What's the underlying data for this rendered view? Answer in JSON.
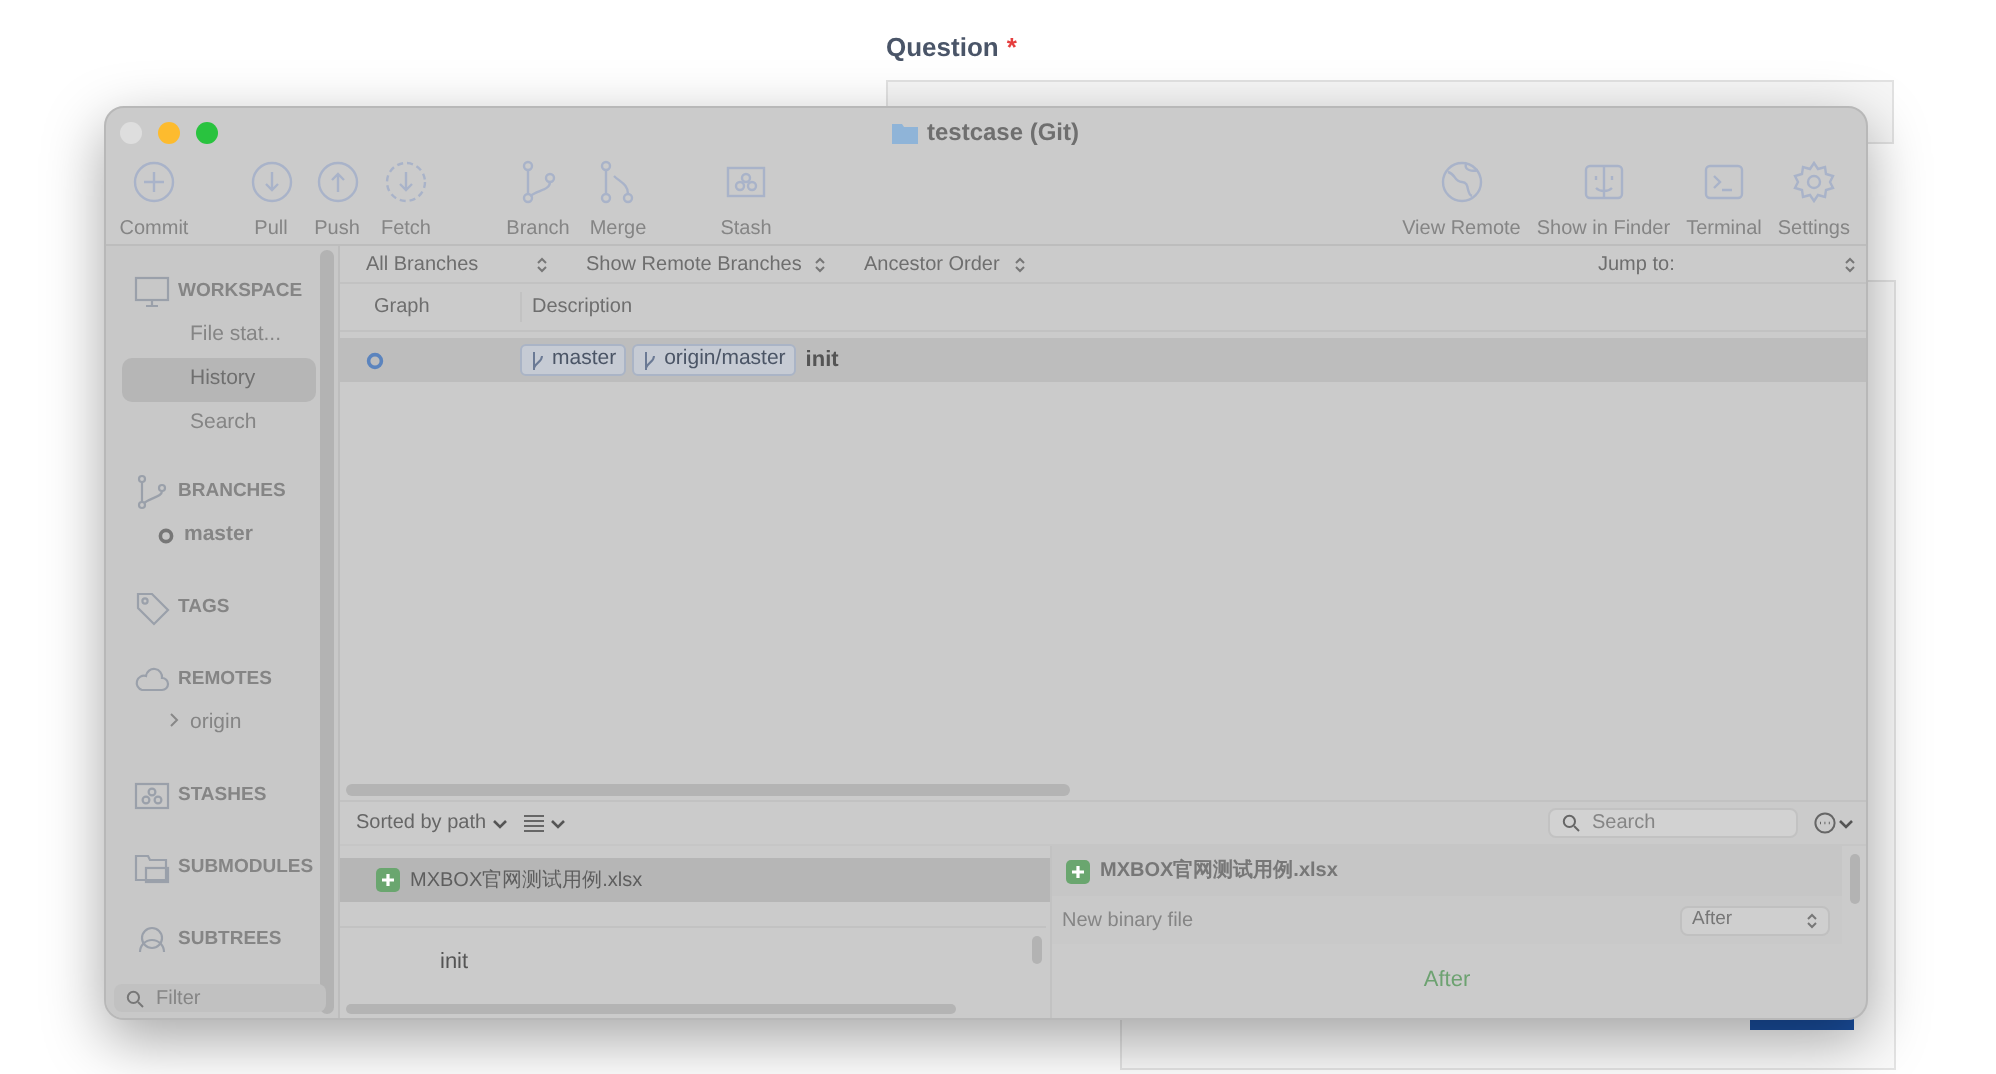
{
  "page": {
    "question_label": "Question",
    "required_mark": "*"
  },
  "window": {
    "title": "testcase (Git)"
  },
  "toolbar": {
    "left": [
      {
        "label": "Commit"
      },
      {
        "label": "Pull"
      },
      {
        "label": "Push"
      },
      {
        "label": "Fetch"
      },
      {
        "label": "Branch"
      },
      {
        "label": "Merge"
      },
      {
        "label": "Stash"
      }
    ],
    "right": [
      {
        "label": "View Remote"
      },
      {
        "label": "Show in Finder"
      },
      {
        "label": "Terminal"
      },
      {
        "label": "Settings"
      }
    ]
  },
  "sidebar": {
    "sections": [
      {
        "heading": "WORKSPACE",
        "items": [
          {
            "label": "File stat...",
            "selected": false
          },
          {
            "label": "History",
            "selected": true
          },
          {
            "label": "Search",
            "selected": false
          }
        ]
      },
      {
        "heading": "BRANCHES",
        "items": [
          {
            "label": "master",
            "selected": false
          }
        ]
      },
      {
        "heading": "TAGS"
      },
      {
        "heading": "REMOTES",
        "items": [
          {
            "label": "origin",
            "selected": false,
            "expanded": false
          }
        ]
      },
      {
        "heading": "STASHES"
      },
      {
        "heading": "SUBMODULES"
      },
      {
        "heading": "SUBTREES"
      }
    ],
    "filter_placeholder": "Filter"
  },
  "history": {
    "filters": [
      "All Branches",
      "Show Remote Branches",
      "Ancestor Order"
    ],
    "jump_to": "Jump to:",
    "columns": [
      "Graph",
      "Description"
    ],
    "commits": [
      {
        "branches": [
          "master",
          "origin/master"
        ],
        "message": "init",
        "selected": true
      }
    ]
  },
  "changes": {
    "sort": "Sorted by path",
    "search_placeholder": "Search",
    "files": [
      {
        "name": "MXBOX官网测试用例.xlsx",
        "selected": true
      }
    ],
    "commit_message": "init",
    "diff": {
      "file": "MXBOX官网测试用例.xlsx",
      "info": "New binary file",
      "mode": "After",
      "body": "After"
    }
  }
}
